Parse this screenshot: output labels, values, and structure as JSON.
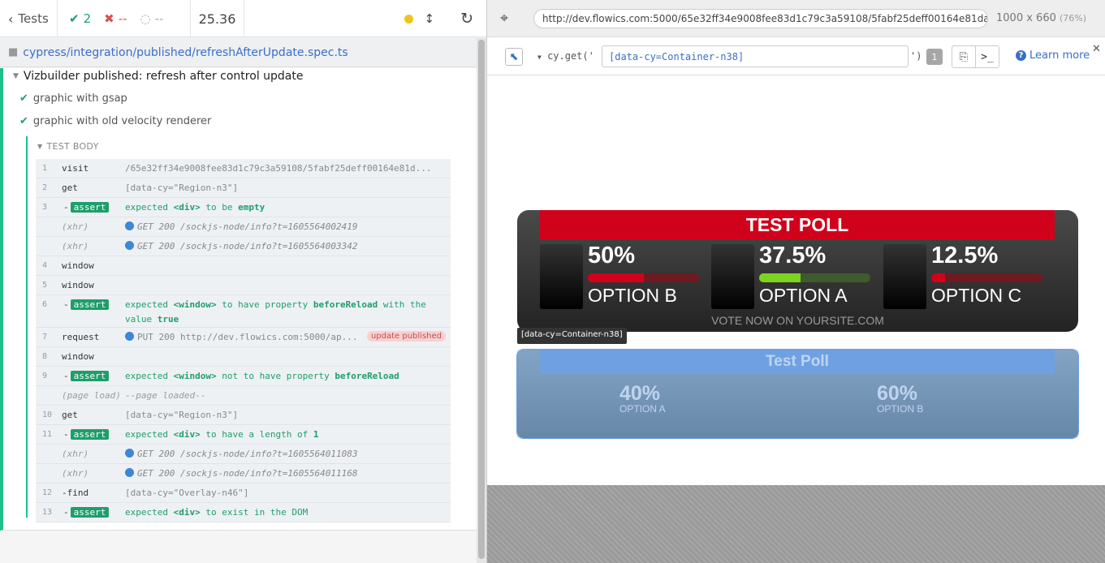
{
  "reporter": {
    "tests_label": "Tests",
    "passed": "2",
    "failed": "--",
    "pending": "--",
    "duration": "25.36",
    "spec_path": "cypress/integration/published/refreshAfterUpdate.spec.ts",
    "suite_title": "Vizbuilder published: refresh after control update",
    "tests": [
      {
        "title": "graphic with gsap"
      },
      {
        "title": "graphic with old velocity renderer"
      }
    ],
    "test_body_label": "TEST BODY",
    "commands": [
      {
        "num": "1",
        "name": "visit",
        "message": "/65e32ff34e9008fee83d1c79c3a59108/5fabf25deff00164e81d..."
      },
      {
        "num": "2",
        "name": "get",
        "message": "[data-cy=\"Region-n3\"]"
      },
      {
        "num": "3",
        "name": "-",
        "tag": "assert",
        "message": "expected <div> to be empty"
      },
      {
        "num": "",
        "name": "(xhr)",
        "message": "GET 200 /sockjs-node/info?t=1605564002419"
      },
      {
        "num": "",
        "name": "(xhr)",
        "message": "GET 200 /sockjs-node/info?t=1605564003342"
      },
      {
        "num": "4",
        "name": "window",
        "message": ""
      },
      {
        "num": "5",
        "name": "window",
        "message": ""
      },
      {
        "num": "6",
        "name": "-",
        "tag": "assert",
        "message": "expected <window> to have property beforeReload with the value true"
      },
      {
        "num": "7",
        "name": "request",
        "message": "PUT 200 http://dev.flowics.com:5000/ap...",
        "badge": "update published"
      },
      {
        "num": "8",
        "name": "window",
        "message": ""
      },
      {
        "num": "9",
        "name": "-",
        "tag": "assert",
        "message": "expected <window> not to have property beforeReload"
      },
      {
        "num": "",
        "name": "(page load)",
        "message": "--page loaded--"
      },
      {
        "num": "10",
        "name": "get",
        "message": "[data-cy=\"Region-n3\"]"
      },
      {
        "num": "11",
        "name": "-",
        "tag": "assert",
        "message": "expected <div> to have a length of 1"
      },
      {
        "num": "",
        "name": "(xhr)",
        "message": "GET 200 /sockjs-node/info?t=1605564011083"
      },
      {
        "num": "",
        "name": "(xhr)",
        "message": "GET 200 /sockjs-node/info?t=1605564011168"
      },
      {
        "num": "12",
        "name": "-find",
        "message": "[data-cy=\"Overlay-n46\"]"
      },
      {
        "num": "13",
        "name": "-",
        "tag": "assert",
        "message": "expected <div> to exist in the DOM"
      }
    ]
  },
  "preview": {
    "url": "http://dev.flowics.com:5000/65e32ff34e9008fee83d1c79c3a59108/5fabf25deff00164e81da",
    "viewport": "1000 x 660",
    "scale": "(76%)",
    "selector_method_open": "cy.get('",
    "selector_value": "[data-cy=Container-n38]",
    "selector_method_close": "')",
    "match_count": "1",
    "learn_more": "Learn more",
    "highlight_tooltip": "[data-cy=Container-n38]"
  },
  "poll1": {
    "title": "TEST POLL",
    "footer": "VOTE NOW ON YOURSITE.COM",
    "options": [
      {
        "pct": "50%",
        "label": "OPTION B",
        "fraction": 0.5,
        "color": "#d0021b",
        "track": "#6e1a22"
      },
      {
        "pct": "37.5%",
        "label": "OPTION A",
        "fraction": 0.375,
        "color": "#7ed321",
        "track": "#3f5a2c"
      },
      {
        "pct": "12.5%",
        "label": "OPTION C",
        "fraction": 0.125,
        "color": "#d0021b",
        "track": "#6e1a22"
      }
    ]
  },
  "poll2": {
    "title": "Test Poll",
    "options": [
      {
        "pct": "40%",
        "label": "OPTION A"
      },
      {
        "pct": "60%",
        "label": "OPTION B"
      }
    ]
  },
  "colors": {
    "pass": "#1e9e6a",
    "fail": "#d6534a",
    "link": "#3a6fc8",
    "poll_red": "#d0021b",
    "poll_green": "#7ed321"
  }
}
